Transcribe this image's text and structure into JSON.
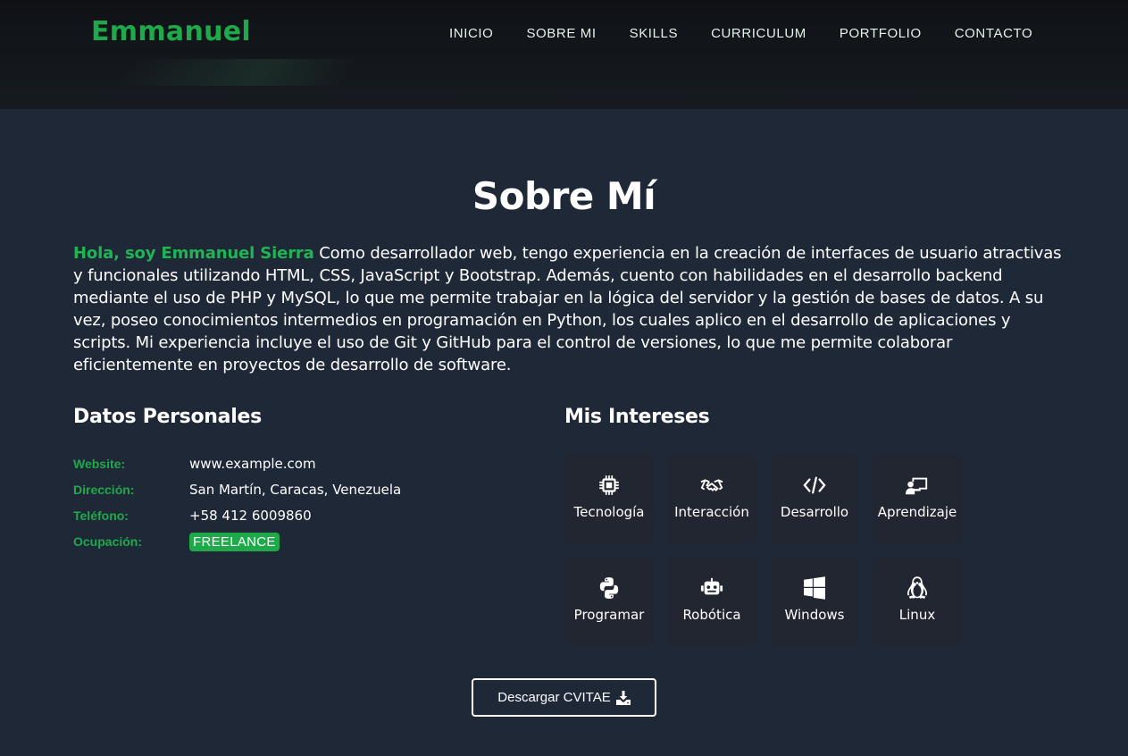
{
  "header": {
    "logo": "Emmanuel",
    "nav": [
      "INICIO",
      "SOBRE MI",
      "SKILLS",
      "CURRICULUM",
      "PORTFOLIO",
      "CONTACTO"
    ]
  },
  "about": {
    "title": "Sobre Mí",
    "intro_highlight": "Hola, soy Emmanuel Sierra",
    "intro_text": " Como desarrollador web, tengo experiencia en la creación de interfaces de usuario atractivas y funcionales utilizando HTML, CSS, JavaScript y Bootstrap. Además, cuento con habilidades en el desarrollo backend mediante el uso de PHP y MySQL, lo que me permite trabajar en la lógica del servidor y la gestión de bases de datos. A su vez, poseo conocimientos intermedios en programación en Python, los cuales aplico en el desarrollo de aplicaciones y scripts. Mi experiencia incluye el uso de Git y GitHub para el control de versiones, lo que me permite colaborar eficientemente en proyectos de desarrollo de software."
  },
  "personal": {
    "title": "Datos Personales",
    "rows": [
      {
        "key": "Website:",
        "value": "www.example.com"
      },
      {
        "key": "Dirección:",
        "value": "San Martín, Caracas, Venezuela"
      },
      {
        "key": "Teléfono:",
        "value": "+58 412 6009860"
      },
      {
        "key": "Ocupación:",
        "value": "FREELANCE"
      }
    ]
  },
  "interests": {
    "title": "Mis Intereses",
    "items": [
      {
        "label": "Tecnología",
        "icon": "chip-icon"
      },
      {
        "label": "Interacción",
        "icon": "handshake-icon"
      },
      {
        "label": "Desarrollo",
        "icon": "code-icon"
      },
      {
        "label": "Aprendizaje",
        "icon": "teacher-icon"
      },
      {
        "label": "Programar",
        "icon": "python-icon"
      },
      {
        "label": "Robótica",
        "icon": "robot-icon"
      },
      {
        "label": "Windows",
        "icon": "windows-icon"
      },
      {
        "label": "Linux",
        "icon": "linux-icon"
      }
    ]
  },
  "download": {
    "label": "Descargar CVITAE"
  },
  "colors": {
    "accent": "#1fa94b",
    "background": "#1f2837",
    "card": "#222630",
    "header": "#13171c"
  }
}
